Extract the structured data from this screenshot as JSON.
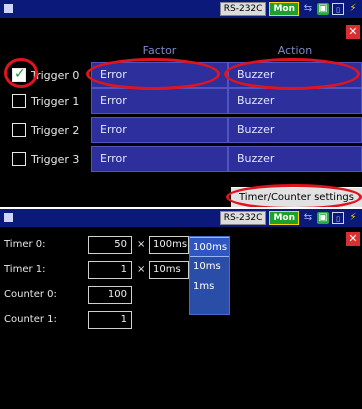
{
  "top_panel": {
    "status": {
      "port": "RS-232C",
      "mode": "Mon"
    },
    "close_label": "✕",
    "headers": {
      "factor": "Factor",
      "action": "Action"
    },
    "triggers": [
      {
        "label": "Trigger 0",
        "checked": true,
        "factor": "Error",
        "action": "Buzzer"
      },
      {
        "label": "Trigger 1",
        "checked": false,
        "factor": "Error",
        "action": "Buzzer"
      },
      {
        "label": "Trigger 2",
        "checked": false,
        "factor": "Error",
        "action": "Buzzer"
      },
      {
        "label": "Trigger 3",
        "checked": false,
        "factor": "Error",
        "action": "Buzzer"
      }
    ],
    "settings_button": "Timer/Counter settings",
    "highlight_color": "#e0141e"
  },
  "bottom_panel": {
    "status": {
      "port": "RS-232C",
      "mode": "Mon"
    },
    "close_label": "✕",
    "rows": [
      {
        "label": "Timer 0:",
        "value": "50",
        "times": "×",
        "unit": "100ms"
      },
      {
        "label": "Timer 1:",
        "value": "1",
        "times": "×",
        "unit": "10ms"
      },
      {
        "label": "Counter 0:",
        "value": "100"
      },
      {
        "label": "Counter 1:",
        "value": "1"
      }
    ],
    "unit_dropdown": {
      "options": [
        "100ms",
        "10ms",
        "1ms"
      ],
      "selected": "100ms"
    }
  }
}
